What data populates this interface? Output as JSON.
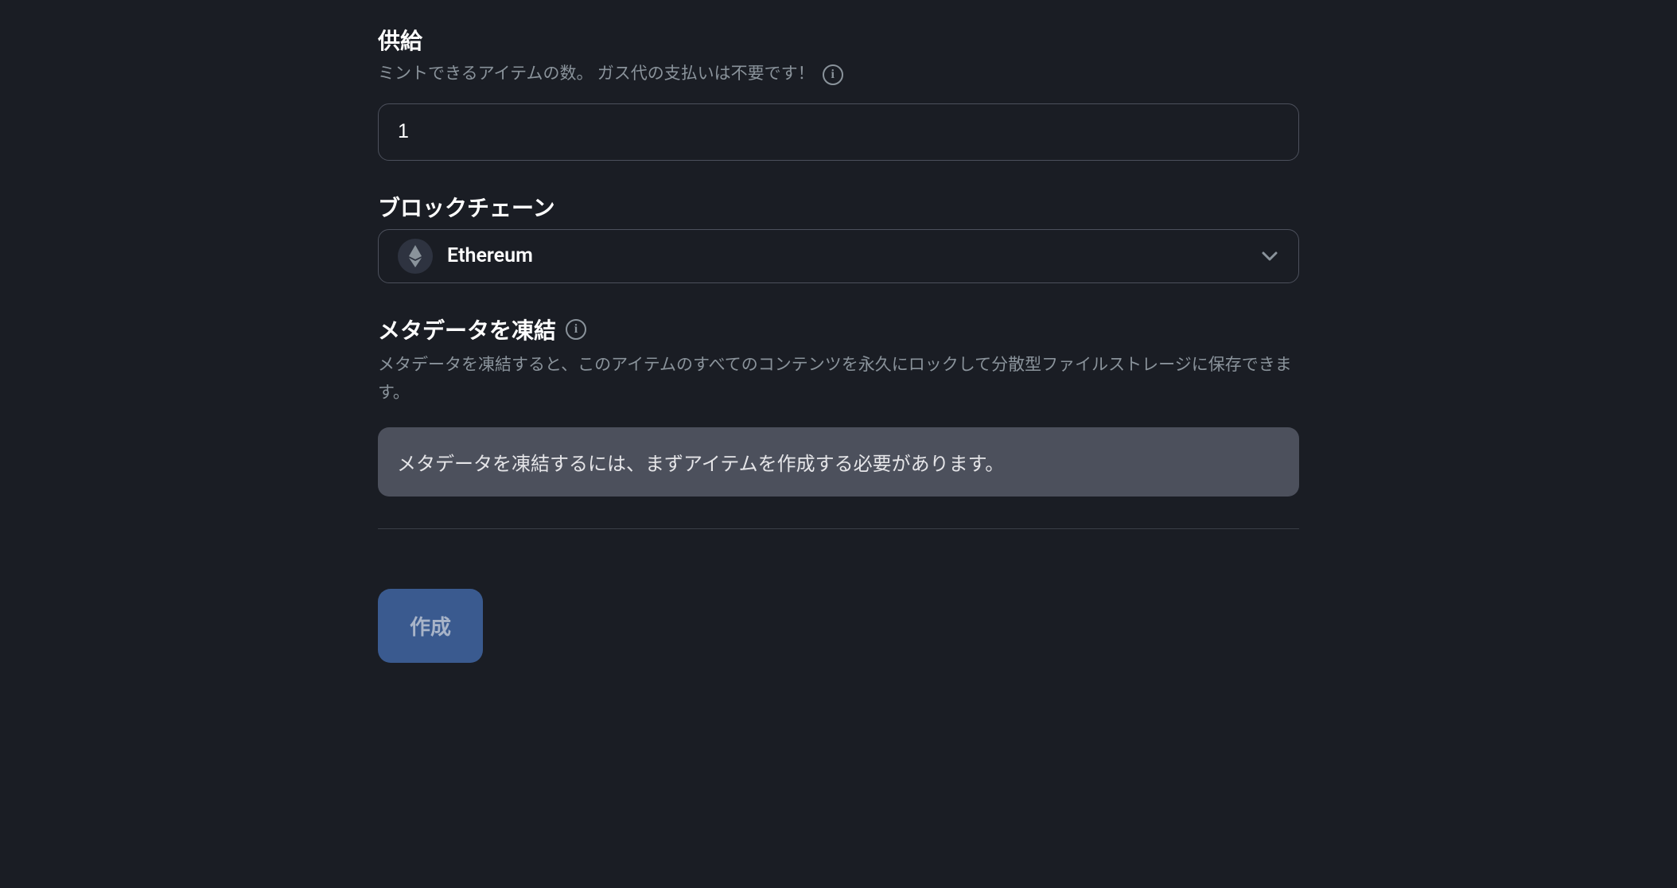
{
  "supply": {
    "label": "供給",
    "description": "ミントできるアイテムの数。 ガス代の支払いは不要です！",
    "value": "1"
  },
  "blockchain": {
    "label": "ブロックチェーン",
    "selected": "Ethereum"
  },
  "freeze_metadata": {
    "label": "メタデータを凍結",
    "description": "メタデータを凍結すると、このアイテムのすべてのコンテンツを永久にロックして分散型ファイルストレージに保存できます。",
    "notice": "メタデータを凍結するには、まずアイテムを作成する必要があります。"
  },
  "create_button": "作成"
}
